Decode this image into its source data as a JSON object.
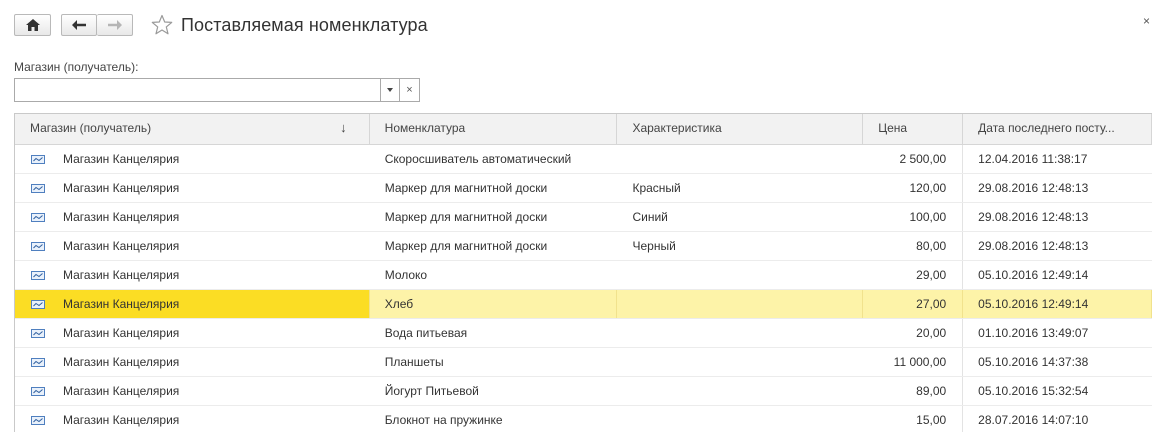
{
  "window": {
    "title": "Поставляемая номенклатура",
    "close_label": "×"
  },
  "filter": {
    "label": "Магазин (получатель):",
    "value": "",
    "placeholder": "",
    "clear_label": "×"
  },
  "table": {
    "columns": [
      "Магазин (получатель)",
      "Номенклатура",
      "Характеристика",
      "Цена",
      "Дата последнего посту..."
    ],
    "sort_indicator": "↓",
    "selected_row_index": 5,
    "rows": [
      [
        "Магазин Канцелярия",
        "Скоросшиватель автоматический",
        "",
        "2 500,00",
        "12.04.2016 11:38:17"
      ],
      [
        "Магазин Канцелярия",
        "Маркер для магнитной доски",
        "Красный",
        "120,00",
        "29.08.2016 12:48:13"
      ],
      [
        "Магазин Канцелярия",
        "Маркер для магнитной доски",
        "Синий",
        "100,00",
        "29.08.2016 12:48:13"
      ],
      [
        "Магазин Канцелярия",
        "Маркер для магнитной доски",
        "Черный",
        "80,00",
        "29.08.2016 12:48:13"
      ],
      [
        "Магазин Канцелярия",
        "Молоко",
        "",
        "29,00",
        "05.10.2016 12:49:14"
      ],
      [
        "Магазин Канцелярия",
        "Хлеб",
        "",
        "27,00",
        "05.10.2016 12:49:14"
      ],
      [
        "Магазин Канцелярия",
        "Вода питьевая",
        "",
        "20,00",
        "01.10.2016 13:49:07"
      ],
      [
        "Магазин Канцелярия",
        "Планшеты",
        "",
        "11 000,00",
        "05.10.2016 14:37:38"
      ],
      [
        "Магазин Канцелярия",
        "Йогурт Питьевой",
        "",
        "89,00",
        "05.10.2016 15:32:54"
      ],
      [
        "Магазин Канцелярия",
        "Блокнот на пружинке",
        "",
        "15,00",
        "28.07.2016 14:07:10"
      ]
    ]
  },
  "colors": {
    "selected_row": "#fdf3a8",
    "selected_cell": "#fbdd24",
    "header_bg": "#f2f2f2"
  }
}
